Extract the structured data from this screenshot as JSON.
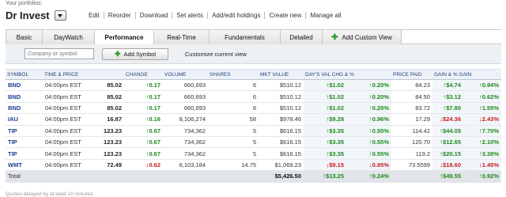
{
  "header": {
    "your_portfolios_label": "Your portfolios:",
    "portfolio_name": "Dr Invest",
    "actions": [
      "Edit",
      "Reorder",
      "Download",
      "Set alerts",
      "Add/edit holdings",
      "Create new",
      "Manage all"
    ]
  },
  "tabs": [
    {
      "label": "Basic",
      "active": false
    },
    {
      "label": "DayWatch",
      "active": false
    },
    {
      "label": "Performance",
      "active": true
    },
    {
      "label": "Real-Time",
      "active": false
    },
    {
      "label": "Fundamentals",
      "active": false
    },
    {
      "label": "Detailed",
      "active": false
    },
    {
      "label": "Add Custom View",
      "active": false,
      "icon": "plus-icon"
    }
  ],
  "toolbar": {
    "symbol_placeholder": "Company or symbol",
    "add_symbol_label": "Add Symbol",
    "customize_label": "Customize current view"
  },
  "table": {
    "columns": [
      "SYMBOL",
      "TIME & PRICE",
      "CHANGE",
      "VOLUME",
      "SHARES",
      "MKT VALUE",
      "DAY'S VAL CHG & %",
      "PRICE PAID",
      "GAIN & % GAIN"
    ],
    "rows": [
      {
        "symbol": "BND",
        "time": "04:00pm EST",
        "price": "85.02",
        "change": "0.17",
        "change_dir": "up",
        "volume": "660,693",
        "shares": "6",
        "mkt_value": "$510.12",
        "day_chg": "$1.02",
        "day_pct": "0.20%",
        "day_dir": "up",
        "price_paid": "84.23",
        "gain": "$4.74",
        "gain_pct": "0.94%",
        "gain_dir": "up"
      },
      {
        "symbol": "BND",
        "time": "04:00pm EST",
        "price": "85.02",
        "change": "0.17",
        "change_dir": "up",
        "volume": "660,693",
        "shares": "6",
        "mkt_value": "$510.12",
        "day_chg": "$1.02",
        "day_pct": "0.20%",
        "day_dir": "up",
        "price_paid": "84.50",
        "gain": "$3.12",
        "gain_pct": "0.62%",
        "gain_dir": "up"
      },
      {
        "symbol": "BND",
        "time": "04:00pm EST",
        "price": "85.02",
        "change": "0.17",
        "change_dir": "up",
        "volume": "660,693",
        "shares": "6",
        "mkt_value": "$510.12",
        "day_chg": "$1.02",
        "day_pct": "0.20%",
        "day_dir": "up",
        "price_paid": "83.72",
        "gain": "$7.80",
        "gain_pct": "1.55%",
        "gain_dir": "up"
      },
      {
        "symbol": "IAU",
        "time": "04:00pm EST",
        "price": "16.87",
        "change": "0.16",
        "change_dir": "up",
        "volume": "8,106,274",
        "shares": "58",
        "mkt_value": "$978.46",
        "day_chg": "$9.28",
        "day_pct": "0.96%",
        "day_dir": "up",
        "price_paid": "17.29",
        "gain": "$24.36",
        "gain_pct": "2.43%",
        "gain_dir": "down"
      },
      {
        "symbol": "TIP",
        "time": "04:00pm EST",
        "price": "123.23",
        "change": "0.67",
        "change_dir": "up",
        "volume": "734,362",
        "shares": "5",
        "mkt_value": "$616.15",
        "day_chg": "$3.35",
        "day_pct": "0.55%",
        "day_dir": "up",
        "price_paid": "114.42",
        "gain": "$44.05",
        "gain_pct": "7.70%",
        "gain_dir": "up"
      },
      {
        "symbol": "TIP",
        "time": "04:00pm EST",
        "price": "123.23",
        "change": "0.67",
        "change_dir": "up",
        "volume": "734,362",
        "shares": "5",
        "mkt_value": "$616.15",
        "day_chg": "$3.35",
        "day_pct": "0.55%",
        "day_dir": "up",
        "price_paid": "120.70",
        "gain": "$12.65",
        "gain_pct": "2.10%",
        "gain_dir": "up"
      },
      {
        "symbol": "TIP",
        "time": "04:00pm EST",
        "price": "123.23",
        "change": "0.67",
        "change_dir": "up",
        "volume": "734,362",
        "shares": "5",
        "mkt_value": "$616.15",
        "day_chg": "$3.35",
        "day_pct": "0.55%",
        "day_dir": "up",
        "price_paid": "119.2",
        "gain": "$20.15",
        "gain_pct": "3.38%",
        "gain_dir": "up"
      },
      {
        "symbol": "WMT",
        "time": "04:00pm EST",
        "price": "72.49",
        "change": "0.62",
        "change_dir": "down",
        "volume": "6,103,184",
        "shares": "14.75",
        "mkt_value": "$1,069.23",
        "day_chg": "$9.15",
        "day_pct": "0.85%",
        "day_dir": "down",
        "price_paid": "73.5599",
        "gain": "$18.60",
        "gain_pct": "1.45%",
        "gain_dir": "down"
      }
    ],
    "total": {
      "label": "Total",
      "mkt_value": "$5,426.50",
      "day_chg": "$13.25",
      "day_pct": "0.24%",
      "gain": "$49.55",
      "gain_pct": "0.92%"
    }
  },
  "footnote": "Quotes delayed by at least 20 minutes.",
  "colors": {
    "up": "#1d8a1d",
    "down": "#c81e1e",
    "symbol": "#1a3d8f",
    "header_text": "#1d3f78"
  }
}
